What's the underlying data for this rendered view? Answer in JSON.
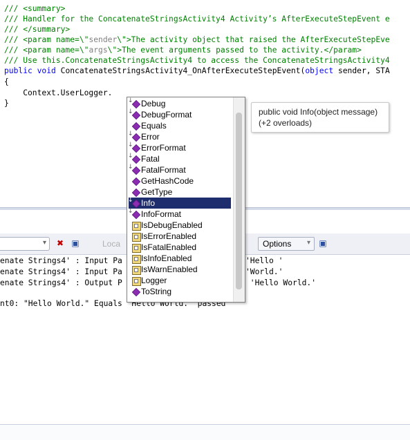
{
  "code": {
    "summary_open": "/// <summary>",
    "summary_text": "/// Handler for the ConcatenateStringsActivity4 Activity’s AfterExecuteStepEvent e",
    "summary_close": "/// </summary>",
    "param_sender_open": "/// <param name=\\\"",
    "param_sender_name": "sender",
    "param_sender_mid": "\\\">",
    "param_sender_text": "The activity object that raised the AfterExecuteStepEve",
    "param_args_open": "/// <param name=\\\"",
    "param_args_name": "args",
    "param_args_mid": "\\\">",
    "param_args_text": "The event arguments passed to the activity.</param>",
    "use_line": "/// Use this.ConcatenateStringsActivity4 to access the ConcatenateStringsActivity4",
    "sig_kw1": "public",
    "sig_kw2": "void",
    "sig_name": "ConcatenateStringsActivity4_OnAfterExecuteStepEvent(",
    "sig_kw3": "object",
    "sig_rest": " sender, STA",
    "brace_open": "{",
    "body": "    Context.UserLogger.",
    "brace_close": "}"
  },
  "toolbar": {
    "combo_arrow": "▾",
    "close_icon": "✖",
    "window_icon": "▣",
    "locals_text": "Loca",
    "options_label": "Options",
    "options_arrow": "▾"
  },
  "output_lines": [
    "enate Strings4' : Input Pa",
    "enate Strings4' : Input Pa",
    "enate Strings4' : Output P",
    "nt0: \"Hello World.\" Equals \"Hello World.\" passed"
  ],
  "output_values": [
    "'Hello '",
    "'World.'",
    " 'Hello World.'"
  ],
  "intellisense": {
    "items": [
      {
        "label": "Debug",
        "kind": "extension-method"
      },
      {
        "label": "DebugFormat",
        "kind": "extension-method"
      },
      {
        "label": "Equals",
        "kind": "method"
      },
      {
        "label": "Error",
        "kind": "extension-method"
      },
      {
        "label": "ErrorFormat",
        "kind": "extension-method"
      },
      {
        "label": "Fatal",
        "kind": "extension-method"
      },
      {
        "label": "FatalFormat",
        "kind": "extension-method"
      },
      {
        "label": "GetHashCode",
        "kind": "method"
      },
      {
        "label": "GetType",
        "kind": "method"
      },
      {
        "label": "Info",
        "kind": "extension-method",
        "selected": true
      },
      {
        "label": "InfoFormat",
        "kind": "extension-method"
      },
      {
        "label": "IsDebugEnabled",
        "kind": "property"
      },
      {
        "label": "IsErrorEnabled",
        "kind": "property"
      },
      {
        "label": "IsFatalEnabled",
        "kind": "property"
      },
      {
        "label": "IsInfoEnabled",
        "kind": "property"
      },
      {
        "label": "IsWarnEnabled",
        "kind": "property"
      },
      {
        "label": "Logger",
        "kind": "property"
      },
      {
        "label": "ToString",
        "kind": "method"
      }
    ]
  },
  "tooltip": {
    "signature": "public void Info(object message)",
    "overloads": "(+2 overloads)"
  }
}
